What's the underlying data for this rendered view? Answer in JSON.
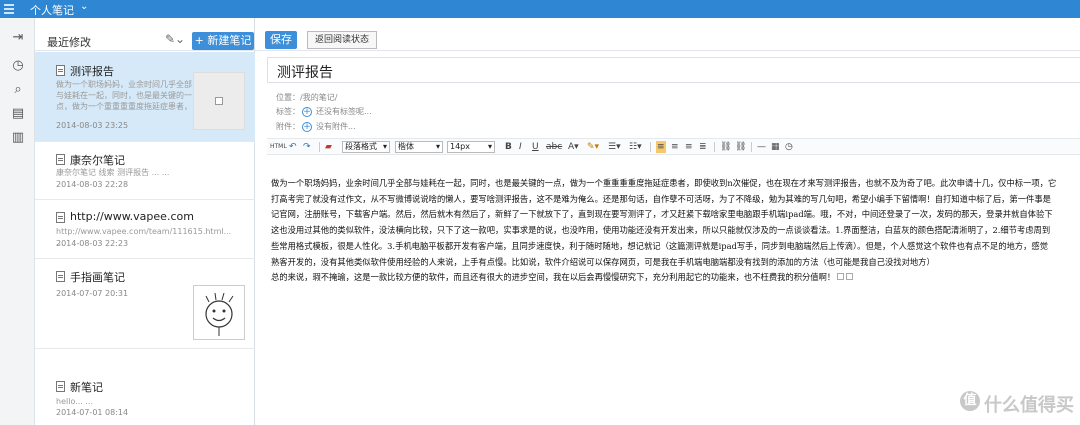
{
  "app": {
    "notebook_title": "个人笔记"
  },
  "list": {
    "header_label": "最近修改",
    "new_button": "+ 新建笔记",
    "notes": [
      {
        "title": "测评报告",
        "snippet": "做为一个职场妈妈，业余时间几乎全部与娃耗在一起，同时，也是最关键的一点，做为一个重重重重度拖延症患者，即使收到n次催促，...",
        "date": "2014-08-03 23:25",
        "selected": true
      },
      {
        "title": "康奈尔笔记",
        "snippet": "康奈尔笔记 线索 测评报告 ... ...",
        "date": "2014-08-03 22:28",
        "selected": false
      },
      {
        "title": "http://www.vapee.com",
        "snippet": "http://www.vapee.com/team/111615.html... ...",
        "date": "2014-08-03 22:23",
        "selected": false
      },
      {
        "title": "手指画笔记",
        "snippet": "",
        "date": "2014-07-07 20:31",
        "selected": false
      },
      {
        "title": "新笔记",
        "snippet": "hello... ...",
        "date": "2014-07-01 08:14",
        "selected": false
      }
    ]
  },
  "toolbar": {
    "save_label": "保存",
    "back_label": "返回阅读状态"
  },
  "editor": {
    "title": "测评报告",
    "location_label": "位置：",
    "location_value": "/我的笔记/",
    "tags_label": "标签：",
    "tags_placeholder": "还没有标签呢...",
    "attach_label": "附件：",
    "attach_placeholder": "没有附件...",
    "format": {
      "paragraph": "段落格式",
      "font": "楷体",
      "size": "14px"
    },
    "body_lines": [
      "做为一个职场妈妈，业余时间几乎全部与娃耗在一起，同时，也是最关键的一点，做为一个重重重重度拖延症患者，即使收到n次催促，也在现在才来写测评报告，也就不及为奇了吧。此次申请十几，仅中标一项，它",
      "打高考完了就没有过作文，从不写微博说说啥的懒人，要写啥测评报告，这不是难为俺么。还是那句话，自作孽不可活呀，为了不降级，勉为其难的写几句吧，希望小编手下留情啊！自打知道中标了后，第一件事是",
      "记官网，注册账号，下载客户端。然后，然后就木有然后了，新鲜了一下就放下了，直到现在要写测评了，才又赶紧下载啥家里电脑跟手机端ipad端。哦，不对，中间还登录了一次，发码的那天，登录并就自体验下",
      "这也没用过其他的类似软件，没法横向比较，只下了这一款吧，实事求是的说，也没咋用，使用功能还没有开发出来，所以只能就仅涉及的一点谈谈看法。1.界面整洁，白蓝灰的颜色搭配清淅明了，2.细节考虑周到",
      "些常用格式模板，很是人性化。3.手机电脑平板都开发有客户端，且同步速度快，利于随时随地，想记就记（这篇测评就是ipad写手，同步到电脑端然后上传滴）。但是，个人感觉这个软件也有点不足的地方，感觉",
      "熟客开发的，没有其他类似软件使用经验的人来说，上手有点慢。比如说，软件介绍说可以保存网页，可是我在手机端电脑端都没有找到的添加的方法（也可能是我自己没找对地方）",
      "总的来说，瑕不掩瑜，这是一款比较方便的软件，而且还有很大的进步空间，我在以后会再慢慢研究下，充分利用起它的功能来，也不枉费我的积分值啊！"
    ]
  },
  "watermark": {
    "icon": "值",
    "text": "什么值得买"
  }
}
